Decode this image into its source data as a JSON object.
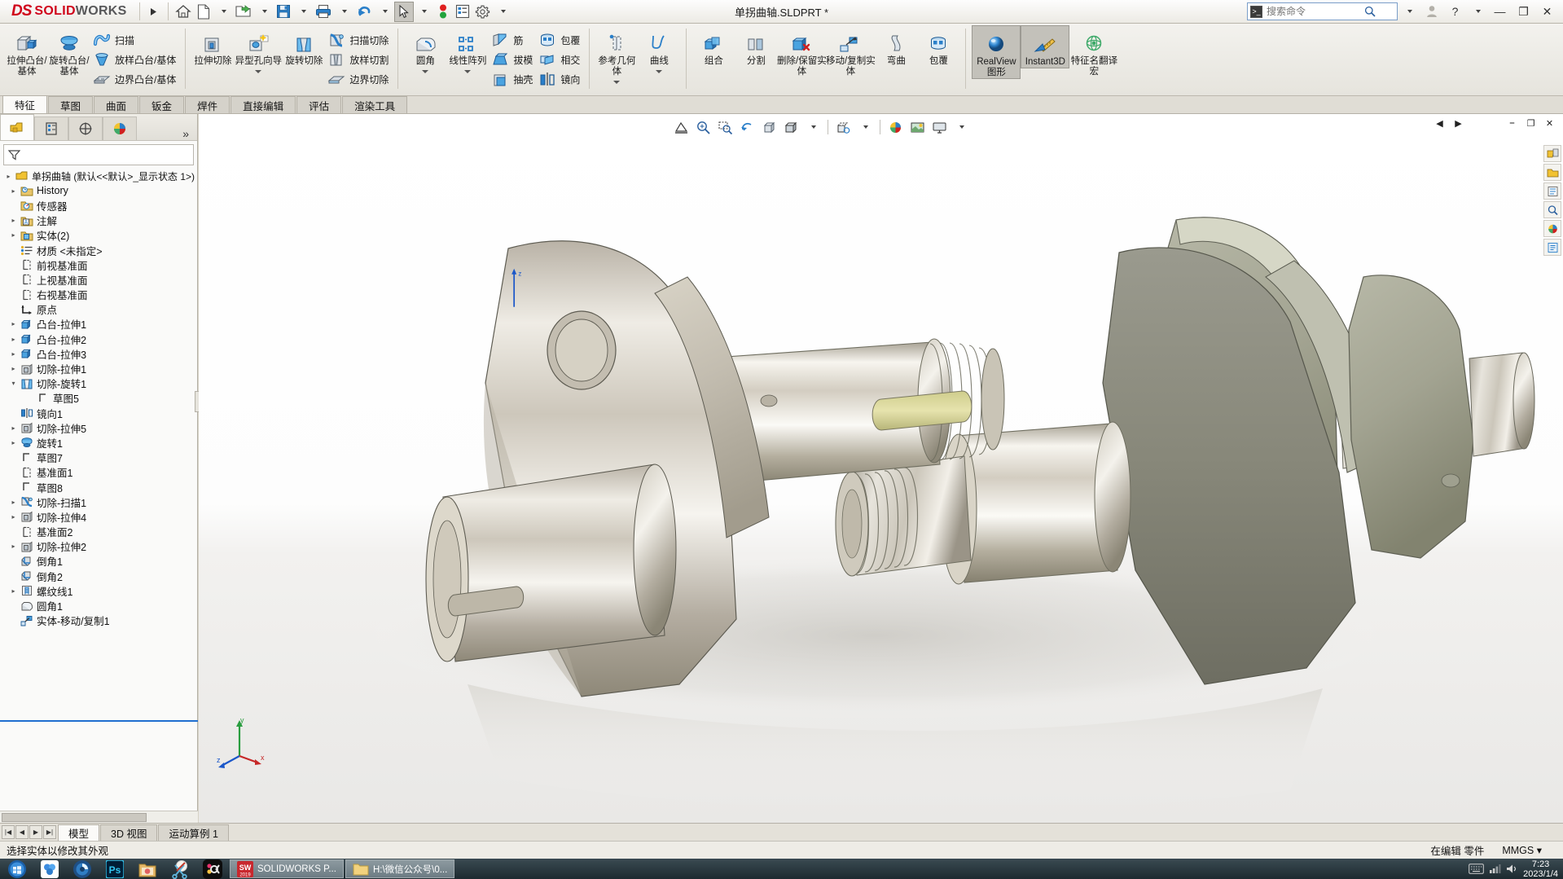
{
  "titlebar": {
    "brand_ds": "DS",
    "brand_solid": "SOLID",
    "brand_works": "WORKS",
    "document_title": "单拐曲轴.SLDPRT *",
    "buttons": [
      {
        "name": "home-button",
        "label": "主页"
      },
      {
        "name": "new-document-button",
        "label": "新建"
      },
      {
        "name": "open-document-button",
        "label": "打开"
      },
      {
        "name": "save-button",
        "label": "保存"
      },
      {
        "name": "print-button",
        "label": "打印"
      },
      {
        "name": "undo-button",
        "label": "撤销"
      },
      {
        "name": "select-button",
        "label": "选择"
      },
      {
        "name": "rebuild-button",
        "label": "重建模型"
      },
      {
        "name": "options-list-button",
        "label": "文件属性"
      },
      {
        "name": "settings-button",
        "label": "选项"
      }
    ],
    "search_placeholder": "搜索命令",
    "help_label": "?",
    "minimize": "—",
    "restore": "❐",
    "close": "✕"
  },
  "ribbon": {
    "groups": [
      {
        "name": "features-boss",
        "big": [
          {
            "label": "拉伸凸台/基体",
            "icon": "extrude-boss-icon"
          },
          {
            "label": "旋转凸台/基体",
            "icon": "revolve-boss-icon"
          }
        ],
        "small": [
          {
            "label": "扫描",
            "icon": "sweep-icon"
          },
          {
            "label": "放样凸台/基体",
            "icon": "loft-boss-icon"
          },
          {
            "label": "边界凸台/基体",
            "icon": "boundary-boss-icon"
          }
        ]
      },
      {
        "name": "features-cut",
        "big": [
          {
            "label": "拉伸切除",
            "icon": "extrude-cut-icon"
          },
          {
            "label": "异型孔向导",
            "icon": "hole-wizard-icon",
            "caret": true
          },
          {
            "label": "旋转切除",
            "icon": "revolve-cut-icon"
          }
        ],
        "small": [
          {
            "label": "扫描切除",
            "icon": "sweep-cut-icon"
          },
          {
            "label": "放样切割",
            "icon": "loft-cut-icon"
          },
          {
            "label": "边界切除",
            "icon": "boundary-cut-icon"
          }
        ]
      },
      {
        "name": "features-modify",
        "big": [
          {
            "label": "圆角",
            "icon": "fillet-icon",
            "caret": true
          },
          {
            "label": "线性阵列",
            "icon": "linear-pattern-icon",
            "caret": true
          }
        ],
        "small": [
          {
            "label": "筋",
            "icon": "rib-icon"
          },
          {
            "label": "拔模",
            "icon": "draft-icon"
          },
          {
            "label": "抽壳",
            "icon": "shell-icon"
          }
        ],
        "small2": [
          {
            "label": "包覆",
            "icon": "wrap-icon"
          },
          {
            "label": "相交",
            "icon": "intersect-icon"
          },
          {
            "label": "镜向",
            "icon": "mirror-icon"
          }
        ]
      },
      {
        "name": "reference-geometry",
        "big": [
          {
            "label": "参考几何体",
            "icon": "reference-geometry-icon",
            "caret": true
          },
          {
            "label": "曲线",
            "icon": "curves-icon",
            "caret": true
          }
        ]
      },
      {
        "name": "bodies",
        "big": [
          {
            "label": "组合",
            "icon": "combine-icon"
          },
          {
            "label": "分割",
            "icon": "split-icon"
          },
          {
            "label": "删除/保留实体",
            "icon": "delete-keep-body-icon"
          },
          {
            "label": "移动/复制实体",
            "icon": "move-copy-body-icon"
          },
          {
            "label": "弯曲",
            "icon": "flex-icon"
          },
          {
            "label": "包覆",
            "icon": "wrap2-icon"
          }
        ]
      },
      {
        "name": "display",
        "big": [
          {
            "label": "RealView 图形",
            "icon": "realview-icon",
            "active": true
          },
          {
            "label": "Instant3D",
            "icon": "instant3d-icon",
            "active": true
          },
          {
            "label": "特征名翻译宏",
            "icon": "feature-translate-icon"
          }
        ]
      }
    ]
  },
  "tabs": {
    "items": [
      {
        "label": "特征",
        "active": true
      },
      {
        "label": "草图",
        "active": false
      },
      {
        "label": "曲面",
        "active": false
      },
      {
        "label": "钣金",
        "active": false
      },
      {
        "label": "焊件",
        "active": false
      },
      {
        "label": "直接编辑",
        "active": false
      },
      {
        "label": "评估",
        "active": false
      },
      {
        "label": "渲染工具",
        "active": false
      }
    ]
  },
  "tree_panel": {
    "tabs": [
      {
        "name": "feature-manager-tab",
        "icon": "feature-tree-icon",
        "active": true
      },
      {
        "name": "property-manager-tab",
        "icon": "property-manager-icon",
        "active": false
      },
      {
        "name": "configuration-manager-tab",
        "icon": "configuration-icon",
        "active": false
      },
      {
        "name": "display-manager-tab",
        "icon": "display-manager-icon",
        "active": false
      }
    ],
    "more_label": "»",
    "filter_placeholder": "",
    "root": "单拐曲轴  (默认<<默认>_显示状态 1>)",
    "items": [
      {
        "label": "History",
        "icon": "history-icon",
        "arrow": true,
        "indent": 0
      },
      {
        "label": "传感器",
        "icon": "sensor-icon",
        "arrow": false,
        "indent": 0
      },
      {
        "label": "注解",
        "icon": "annotation-icon",
        "arrow": true,
        "indent": 0
      },
      {
        "label": "实体(2)",
        "icon": "solid-bodies-icon",
        "arrow": true,
        "indent": 0
      },
      {
        "label": "材质 <未指定>",
        "icon": "material-icon",
        "arrow": false,
        "indent": 0
      },
      {
        "label": "前视基准面",
        "icon": "plane-icon",
        "arrow": false,
        "indent": 0
      },
      {
        "label": "上视基准面",
        "icon": "plane-icon",
        "arrow": false,
        "indent": 0
      },
      {
        "label": "右视基准面",
        "icon": "plane-icon",
        "arrow": false,
        "indent": 0
      },
      {
        "label": "原点",
        "icon": "origin-icon",
        "arrow": false,
        "indent": 0
      },
      {
        "label": "凸台-拉伸1",
        "icon": "boss-extrude-icon",
        "arrow": true,
        "indent": 0
      },
      {
        "label": "凸台-拉伸2",
        "icon": "boss-extrude-icon",
        "arrow": true,
        "indent": 0
      },
      {
        "label": "凸台-拉伸3",
        "icon": "boss-extrude-icon",
        "arrow": true,
        "indent": 0
      },
      {
        "label": "切除-拉伸1",
        "icon": "cut-extrude-icon",
        "arrow": true,
        "indent": 0
      },
      {
        "label": "切除-旋转1",
        "icon": "cut-revolve-icon",
        "arrow": "down",
        "indent": 0
      },
      {
        "label": "草图5",
        "icon": "sketch-icon",
        "arrow": false,
        "indent": 1
      },
      {
        "label": "镜向1",
        "icon": "mirror-feature-icon",
        "arrow": false,
        "indent": 0
      },
      {
        "label": "切除-拉伸5",
        "icon": "cut-extrude-icon",
        "arrow": true,
        "indent": 0
      },
      {
        "label": "旋转1",
        "icon": "revolve-feature-icon",
        "arrow": true,
        "indent": 0
      },
      {
        "label": "草图7",
        "icon": "sketch-icon",
        "arrow": false,
        "indent": 0
      },
      {
        "label": "基准面1",
        "icon": "plane-icon",
        "arrow": false,
        "indent": 0
      },
      {
        "label": "草图8",
        "icon": "sketch-icon",
        "arrow": false,
        "indent": 0
      },
      {
        "label": "切除-扫描1",
        "icon": "cut-sweep-icon",
        "arrow": true,
        "indent": 0
      },
      {
        "label": "切除-拉伸4",
        "icon": "cut-extrude-icon",
        "arrow": true,
        "indent": 0
      },
      {
        "label": "基准面2",
        "icon": "plane-icon",
        "arrow": false,
        "indent": 0
      },
      {
        "label": "切除-拉伸2",
        "icon": "cut-extrude-icon",
        "arrow": true,
        "indent": 0
      },
      {
        "label": "倒角1",
        "icon": "chamfer-icon",
        "arrow": false,
        "indent": 0
      },
      {
        "label": "倒角2",
        "icon": "chamfer-icon",
        "arrow": false,
        "indent": 0
      },
      {
        "label": "螺纹线1",
        "icon": "thread-icon",
        "arrow": true,
        "indent": 0
      },
      {
        "label": "圆角1",
        "icon": "fillet-feature-icon",
        "arrow": false,
        "indent": 0
      },
      {
        "label": "实体-移动/复制1",
        "icon": "move-copy-feature-icon",
        "arrow": false,
        "indent": 0
      }
    ]
  },
  "graphics": {
    "view_toolbar": [
      {
        "name": "section-view-button",
        "icon": "section-view-icon"
      },
      {
        "name": "zoom-to-fit-button",
        "icon": "zoom-fit-icon"
      },
      {
        "name": "zoom-to-area-button",
        "icon": "zoom-area-icon"
      },
      {
        "name": "previous-view-button",
        "icon": "previous-view-icon"
      },
      {
        "name": "view-orientation-button",
        "icon": "view-orientation-icon"
      },
      {
        "name": "display-style-button",
        "icon": "display-style-icon",
        "caret": true
      },
      {
        "name": "hide-show-items-button",
        "icon": "hide-show-icon",
        "caret": true
      },
      {
        "name": "edit-appearance-button",
        "icon": "appearance-icon",
        "caret": true
      },
      {
        "name": "apply-scene-button",
        "icon": "scene-icon",
        "caret": true
      },
      {
        "name": "view-settings-button",
        "icon": "view-settings-icon",
        "caret": true
      }
    ],
    "window_controls": [
      "⎯",
      "❐",
      "✕"
    ],
    "right_dock": [
      {
        "name": "view-palette-button",
        "icon": "view-palette-icon"
      },
      {
        "name": "design-library-button",
        "icon": "design-library-icon"
      },
      {
        "name": "file-explorer-button",
        "icon": "file-explorer-icon"
      },
      {
        "name": "search-panel-button",
        "icon": "search-panel-icon"
      },
      {
        "name": "appearances-panel-button",
        "icon": "appearances-icon"
      },
      {
        "name": "custom-properties-button",
        "icon": "custom-properties-icon"
      }
    ],
    "triad_axes": {
      "x": "x",
      "y": "y",
      "z": "z"
    },
    "model_name": "单拐曲轴"
  },
  "sheet_tabs": {
    "nav": [
      "|◀",
      "◀",
      "▶",
      "▶|"
    ],
    "items": [
      {
        "label": "模型",
        "active": true
      },
      {
        "label": "3D 视图",
        "active": false
      },
      {
        "label": "运动算例 1",
        "active": false
      }
    ]
  },
  "statusbar": {
    "message": "选择实体以修改其外观",
    "editing": "在编辑 零件",
    "units": "MMGS",
    "units_caret": "▾"
  },
  "taskbar": {
    "icons": [
      {
        "name": "start-button",
        "icon": "windows-start-icon"
      },
      {
        "name": "taskbar-app-1",
        "icon": "blue-flower-icon"
      },
      {
        "name": "taskbar-app-2",
        "icon": "camera-lens-icon"
      },
      {
        "name": "taskbar-photoshop",
        "icon": "photoshop-icon",
        "label": "Ps"
      },
      {
        "name": "taskbar-app-4",
        "icon": "photo-folder-icon"
      },
      {
        "name": "taskbar-app-5",
        "icon": "scissors-icon"
      },
      {
        "name": "taskbar-app-6",
        "icon": "circle-k-icon"
      }
    ],
    "tasks": [
      {
        "name": "taskbar-solidworks",
        "label": "SOLIDWORKS P...",
        "icon": "sw-2019-icon",
        "badge": "2019"
      },
      {
        "name": "taskbar-explorer",
        "label": "H:\\微信公众号\\0...",
        "icon": "folder-icon"
      }
    ],
    "clock_time": "7:23",
    "clock_date": "2023/1/4",
    "tray_icons": [
      "keyboard-icon",
      "network-icon",
      "volume-icon"
    ]
  }
}
